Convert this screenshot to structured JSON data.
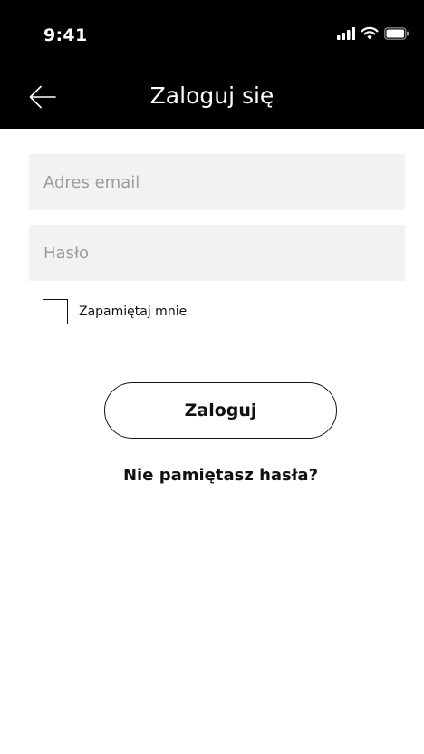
{
  "status_bar": {
    "time": "9:41",
    "icons": [
      "cellular-signal-icon",
      "wifi-icon",
      "battery-icon"
    ]
  },
  "header": {
    "title": "Zaloguj się",
    "back_icon": "arrow-left-icon"
  },
  "form": {
    "email": {
      "placeholder": "Adres email",
      "value": ""
    },
    "password": {
      "placeholder": "Hasło",
      "value": ""
    },
    "remember_me": {
      "label": "Zapamiętaj mnie",
      "checked": false
    },
    "submit_label": "Zaloguj",
    "forgot_password_label": "Nie pamiętasz hasła?"
  },
  "colors": {
    "header_background": "#000000",
    "field_background": "#f2f2f2",
    "placeholder_text": "#9c9c9c",
    "primary_text": "#111111"
  }
}
